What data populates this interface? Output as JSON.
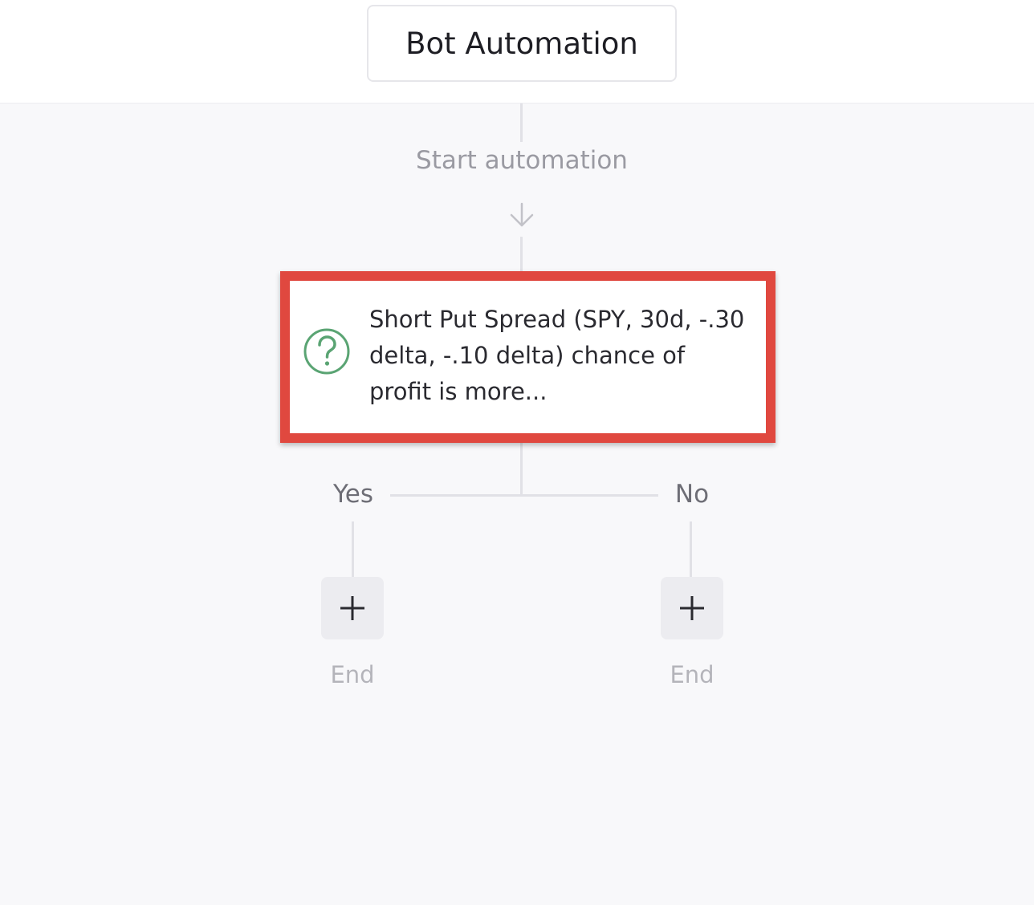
{
  "header": {
    "title": "Bot Automation"
  },
  "flow": {
    "start_label": "Start automation",
    "condition": {
      "text": "Short Put Spread (SPY, 30d, -.30 delta, -.10 delta) chance of profit is more...",
      "icon": "question-icon",
      "icon_color": "#5aa473",
      "highlight_color": "#e0483f"
    },
    "branches": [
      {
        "label": "Yes",
        "add_icon": "plus-icon",
        "end_label": "End"
      },
      {
        "label": "No",
        "add_icon": "plus-icon",
        "end_label": "End"
      }
    ]
  }
}
